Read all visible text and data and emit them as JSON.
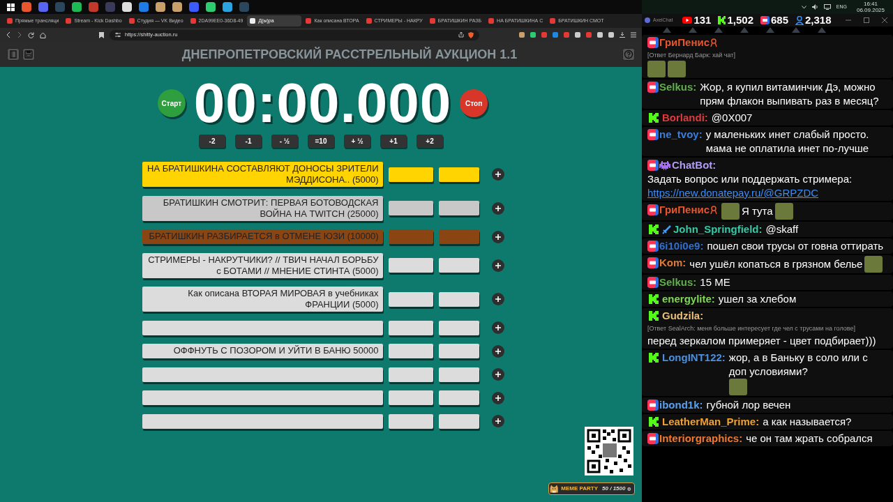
{
  "tray": {
    "language": "ENG",
    "time": "16:41",
    "date": "06.09.2025"
  },
  "browser": {
    "tabs": [
      {
        "title": "Прямые трансляци",
        "selected": false
      },
      {
        "title": "Stream - Kick Dashbo",
        "selected": false
      },
      {
        "title": "Студия — VK Видео",
        "selected": false
      },
      {
        "title": "2DA99EE0-36D8-49",
        "selected": false
      },
      {
        "title": "Д(ы)ра",
        "selected": true
      },
      {
        "title": "Как описана ВТОРА",
        "selected": false
      },
      {
        "title": "СТРИМЕРЫ - НАКРУ",
        "selected": false
      },
      {
        "title": "БРАТИШКИН РАЗБ",
        "selected": false
      },
      {
        "title": "НА БРАТИШКИНА С",
        "selected": false
      },
      {
        "title": "БРАТИШКИН СМОТ",
        "selected": false
      }
    ],
    "url": "https://shitty-auction.ru"
  },
  "app": {
    "title": "ДНЕПРОПЕТРОВСКИЙ РАССТРЕЛЬНЫЙ АУКЦИОН 1.1",
    "start_label": "Старт",
    "timer": "00:00.000",
    "stop_label": "Стоп",
    "adjust_buttons": [
      "-2",
      "-1",
      "- ½",
      "=10",
      "+ ½",
      "+1",
      "+2"
    ],
    "lots": [
      {
        "text": "НА БРАТИШКИНА СОСТАВЛЯЮТ ДОНОСЫ ЗРИТЕЛИ МЭДДИСОНА.. (5000)",
        "color": "#ffd400"
      },
      {
        "text": "БРАТИШКИН СМОТРИТ: ПЕРВАЯ БОТОВОДСКАЯ ВОЙНА НА TWITCH (25000)",
        "color": "#c8c8c8"
      },
      {
        "text": "БРАТИШКИН РАЗБИРАЕТСЯ в ОТМЕНЕ ЮЗИ (10000)",
        "color": "#8b4513"
      },
      {
        "text": "СТРИМЕРЫ - НАКРУТЧИКИ? // ТВИЧ НАЧАЛ БОРЬБУ с БОТАМИ // МНЕНИЕ СТИНТА (5000)",
        "color": "#dcdcdc"
      },
      {
        "text": "Как описана ВТОРАЯ МИРОВАЯ в учебниках ФРАНЦИИ (5000)",
        "color": "#dcdcdc"
      },
      {
        "color": "#dcdcdc"
      },
      {
        "text": "ОФФНУТЬ С ПОЗОРОМ И УЙТИ В БАНЮ 50000",
        "color": "#dcdcdc"
      },
      {
        "color": "#dcdcdc"
      },
      {
        "color": "#dcdcdc"
      },
      {
        "color": "#dcdcdc"
      }
    ]
  },
  "overlay": {
    "widget_title": "MEME PARTY",
    "widget_progress": "50 / 1500"
  },
  "chat": {
    "app_name": "AxelChat",
    "counters": [
      {
        "kind": "youtube",
        "value": "131"
      },
      {
        "kind": "kick",
        "value": "1,502"
      },
      {
        "kind": "vk",
        "value": "685"
      },
      {
        "kind": "viewers",
        "value": "2,318"
      }
    ],
    "messages": [
      {
        "kind": "vk",
        "author": "ГриПенис",
        "badge": {
          "kind": "ribbon"
        },
        "color": "#e8552e",
        "reply": "[Ответ Бернард Барк: хай чат]",
        "parts": [
          {
            "kind": "emote"
          },
          {
            "kind": "emote"
          }
        ]
      },
      {
        "kind": "vk",
        "author": "Selkus:",
        "color": "#5fb04a",
        "parts": [
          {
            "kind": "text",
            "text": "Жор, я купил витаминчик Дэ, можно прям флакон выпивать раз в месяц?"
          }
        ]
      },
      {
        "kind": "kick",
        "author": "Borlandi:",
        "color": "#e0393e",
        "parts": [
          {
            "kind": "text",
            "text": "@0X007"
          }
        ]
      },
      {
        "kind": "vk",
        "author": "ne_tvoy:",
        "color": "#3b7dd8",
        "parts": [
          {
            "kind": "text",
            "text": "у маленьких инет слабый просто. мама не оплатила инет по-лучше"
          }
        ]
      },
      {
        "kind": "vk",
        "author": "ChatBot:",
        "badge": {
          "kind": "invader"
        },
        "color": "#b39cf5",
        "parts": [
          {
            "kind": "text",
            "text": "Задать вопрос или поддержать стримера:"
          },
          {
            "kind": "link",
            "text": "https://new.donatepay.ru/@GRPZDC"
          }
        ]
      },
      {
        "kind": "vk",
        "author": "ГриПенис",
        "badge": {
          "kind": "ribbon"
        },
        "color": "#e8552e",
        "parts": [
          {
            "kind": "emote"
          },
          {
            "kind": "text",
            "text": "Я тута"
          },
          {
            "kind": "emote"
          }
        ]
      },
      {
        "kind": "kick",
        "author": "John_Springfield:",
        "badge": {
          "kind": "sword"
        },
        "color": "#35c9a5",
        "parts": [
          {
            "kind": "text",
            "text": "@skaff"
          }
        ]
      },
      {
        "kind": "vk",
        "author": "6i10i0e9:",
        "color": "#2f6fd0",
        "parts": [
          {
            "kind": "text",
            "text": "пошел свои трусы от говна оттирать"
          }
        ]
      },
      {
        "kind": "vk",
        "author": "Kom:",
        "color": "#e07b39",
        "parts": [
          {
            "kind": "text",
            "text": "чел ушёл копаться в грязном белье"
          },
          {
            "kind": "emote"
          }
        ]
      },
      {
        "kind": "vk",
        "author": "Selkus:",
        "color": "#5fb04a",
        "parts": [
          {
            "kind": "text",
            "text": "15 МЕ"
          }
        ]
      },
      {
        "kind": "kick",
        "author": "energylite:",
        "color": "#7ed957",
        "parts": [
          {
            "kind": "text",
            "text": "ушел за хлебом"
          }
        ]
      },
      {
        "kind": "kick",
        "author": "Gudzila:",
        "color": "#e8c07a",
        "reply": "[Ответ SealArch: меня больше интересует где чел с трусами на голове]",
        "parts": [
          {
            "kind": "text",
            "text": "перед зеркалом примеряет - цвет подбирает)))"
          }
        ]
      },
      {
        "kind": "kick",
        "author": "LongINT122:",
        "color": "#4a8fe0",
        "parts": [
          {
            "kind": "text",
            "text": "жор, а в Баньку в соло или с доп условиями?"
          },
          {
            "kind": "emote"
          }
        ]
      },
      {
        "kind": "vk",
        "author": "ibond1k:",
        "color": "#5aa0f0",
        "parts": [
          {
            "kind": "text",
            "text": "губной лор вечен"
          }
        ]
      },
      {
        "kind": "kick",
        "author": "LeatherMan_Prime:",
        "color": "#f0a030",
        "parts": [
          {
            "kind": "text",
            "text": "а как называется?"
          }
        ]
      },
      {
        "kind": "vk",
        "author": "Interiorgraphics:",
        "color": "#f07830",
        "parts": [
          {
            "kind": "text",
            "text": "че он там жрать собрался"
          }
        ]
      }
    ]
  }
}
